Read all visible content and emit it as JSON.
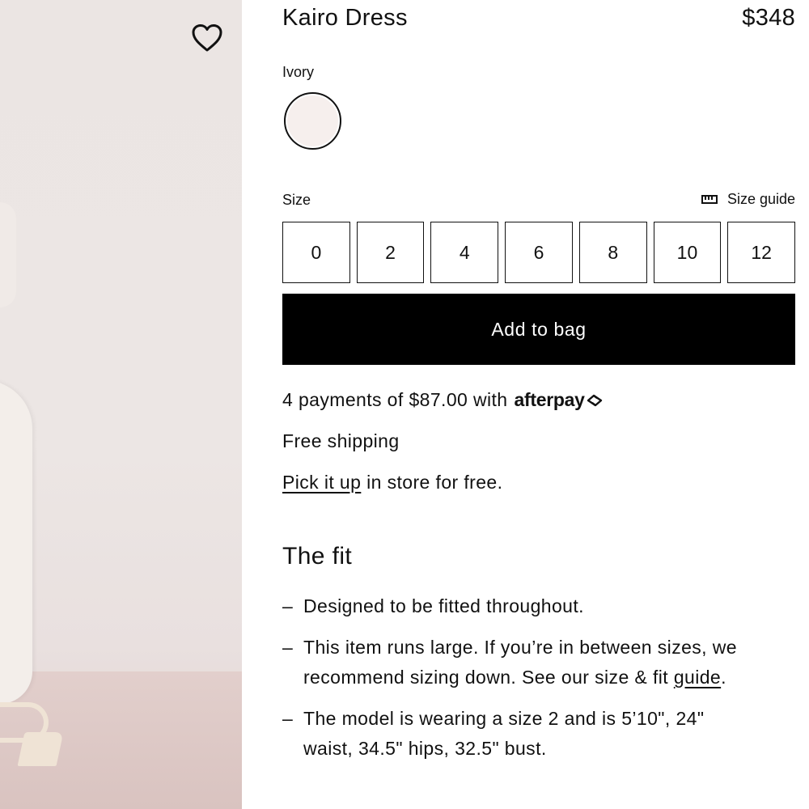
{
  "product": {
    "title": "Kairo Dress",
    "price": "$348",
    "wishlist_icon": "heart-icon"
  },
  "color": {
    "label": "Ivory",
    "swatch_hex": "#f6efed"
  },
  "size": {
    "label": "Size",
    "guide_label": "Size guide",
    "guide_icon": "ruler-icon",
    "options": [
      "0",
      "2",
      "4",
      "6",
      "8",
      "10",
      "12"
    ]
  },
  "cart": {
    "add_label": "Add to bag"
  },
  "info": {
    "payments_text": "4 payments of $87.00 with",
    "afterpay_brand": "afterpay",
    "shipping_text": "Free shipping",
    "pickup_link": "Pick it up",
    "pickup_rest": " in store for free."
  },
  "fit": {
    "heading": "The fit",
    "bullet": "–",
    "item1": "Designed to be fitted throughout.",
    "item2_line1": "This item runs large. If you’re in between sizes, we",
    "item2_line2": "recommend sizing down. See our size & fit ",
    "item2_link": "guide",
    "item2_end": ".",
    "item3_line1": "The model is wearing a size 2 and is 5’10\", 24\"",
    "item3_line2": "waist, 34.5\" hips, 32.5\" bust."
  },
  "colors": {
    "text": "#111111",
    "button_bg": "#000000",
    "button_text": "#ffffff",
    "photo_bg": "#ebe5e3"
  }
}
